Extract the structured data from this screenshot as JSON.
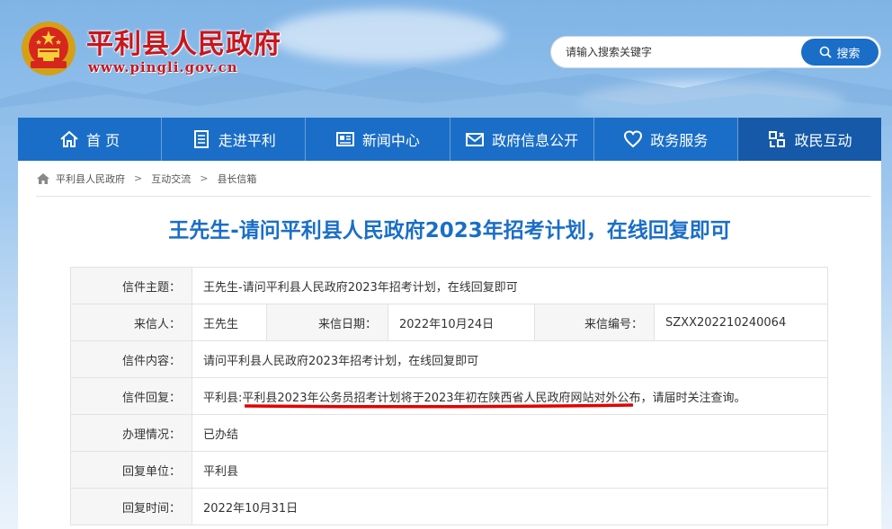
{
  "header": {
    "title": "平利县人民政府",
    "url": "www.pingli.gov.cn"
  },
  "search": {
    "placeholder": "请输入搜索关键字",
    "button_label": "搜索"
  },
  "nav": [
    {
      "label": "首 页",
      "icon": "home-icon"
    },
    {
      "label": "走进平利",
      "icon": "document-icon"
    },
    {
      "label": "新闻中心",
      "icon": "newspaper-icon"
    },
    {
      "label": "政府信息公开",
      "icon": "mail-icon"
    },
    {
      "label": "政务服务",
      "icon": "heart-icon"
    },
    {
      "label": "政民互动",
      "icon": "interaction-icon"
    }
  ],
  "breadcrumb": [
    "平利县人民政府",
    "互动交流",
    "县长信箱"
  ],
  "letter": {
    "page_title": "王先生-请问平利县人民政府2023年招考计划，在线回复即可",
    "subject_label": "信件主题：",
    "subject": "王先生-请问平利县人民政府2023年招考计划，在线回复即可",
    "sender_label": "来信人：",
    "sender": "王先生",
    "date_label": "来信日期：",
    "date": "2022年10月24日",
    "number_label": "来信编号：",
    "number": "SZXX202210240064",
    "content_label": "信件内容：",
    "content": "请问平利县人民政府2023年招考计划，在线回复即可",
    "reply_label": "信件回复：",
    "reply": "平利县:平利县2023年公务员招考计划将于2023年初在陕西省人民政府网站对外公布，请届时关注查询。",
    "status_label": "办理情况：",
    "status": "已办结",
    "unit_label": "回复单位：",
    "unit": "平利县",
    "reply_time_label": "回复时间：",
    "reply_time": "2022年10月31日"
  },
  "colors": {
    "brand_blue": "#1a6ec7",
    "title_red": "#c8161d",
    "highlight_red": "#e10000"
  }
}
